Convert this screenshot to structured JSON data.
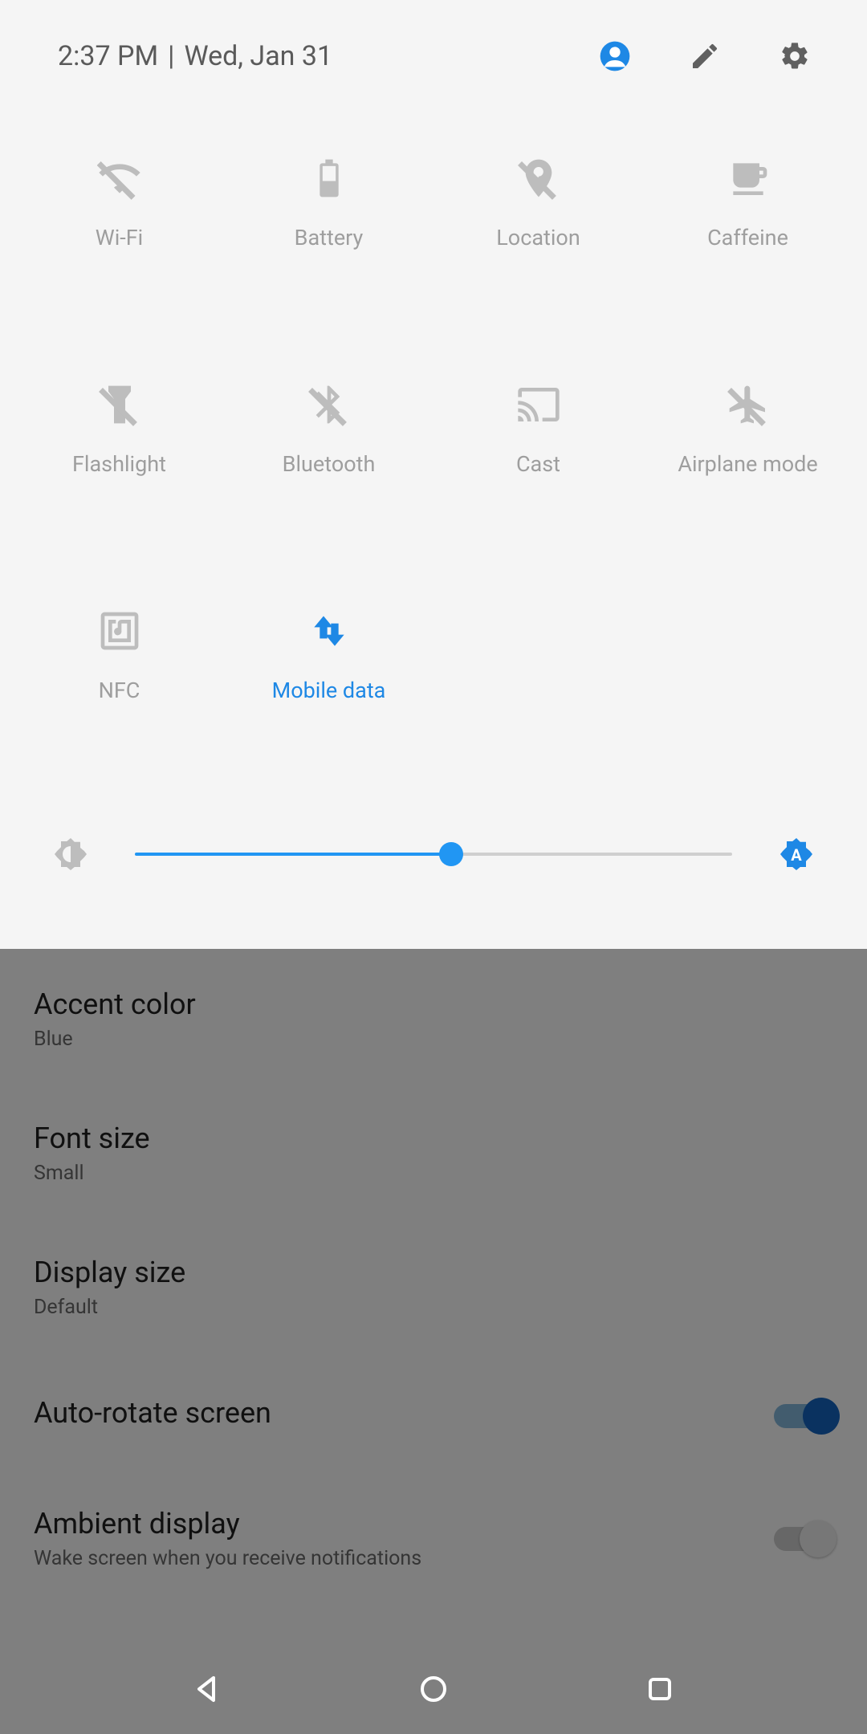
{
  "header": {
    "time": "2:37 PM",
    "sep": "|",
    "date": "Wed, Jan 31"
  },
  "tiles": [
    {
      "label": "Wi-Fi",
      "active": false
    },
    {
      "label": "Battery",
      "active": false
    },
    {
      "label": "Location",
      "active": false
    },
    {
      "label": "Caffeine",
      "active": false
    },
    {
      "label": "Flashlight",
      "active": false
    },
    {
      "label": "Bluetooth",
      "active": false
    },
    {
      "label": "Cast",
      "active": false
    },
    {
      "label": "Airplane mode",
      "active": false
    },
    {
      "label": "NFC",
      "active": false
    },
    {
      "label": "Mobile data",
      "active": true
    }
  ],
  "brightness": {
    "percent": 53
  },
  "settings": [
    {
      "title": "Accent color",
      "sub": "Blue"
    },
    {
      "title": "Font size",
      "sub": "Small"
    },
    {
      "title": "Display size",
      "sub": "Default"
    },
    {
      "title": "Auto-rotate screen",
      "toggle": true,
      "on": true
    },
    {
      "title": "Ambient display",
      "sub": "Wake screen when you receive notifications",
      "toggle": true,
      "on": false
    }
  ],
  "colors": {
    "accent": "#1e88e5"
  }
}
